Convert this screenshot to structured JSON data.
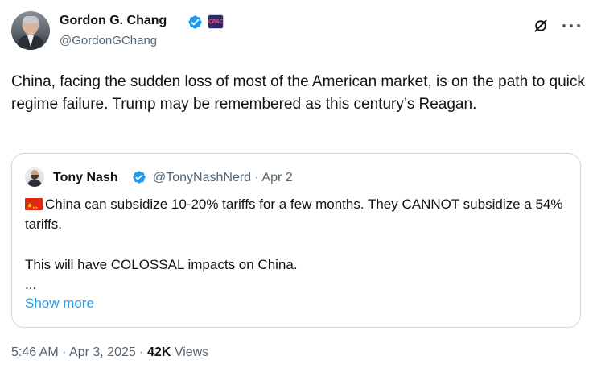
{
  "author": {
    "name": "Gordon G. Chang",
    "handle": "@GordonGChang",
    "verified": true,
    "affiliate_badge": "CPAC"
  },
  "tweet": {
    "text": "China, facing the sudden loss of most of the American market, is on the path to quick regime failure. Trump may be remembered as this century’s Reagan."
  },
  "quoted_tweet": {
    "name": "Tony Nash",
    "handle": "@TonyNashNerd",
    "separator": "·",
    "date": "Apr 2",
    "verified": true,
    "lines": [
      "China can subsidize 10-20% tariffs for a few months. They CANNOT subsidize a 54% tariffs.",
      "",
      "This will have COLOSSAL impacts on China.",
      "..."
    ],
    "flag_icon": "china-flag-icon",
    "show_more_label": "Show more"
  },
  "footer": {
    "time": "5:46 AM",
    "sep1": "·",
    "date": "Apr 3, 2025",
    "sep2": "·",
    "views_count": "42K",
    "views_label": "Views"
  },
  "colors": {
    "text": "#0f1419",
    "secondary": "#536471",
    "link": "#1d9bf0",
    "verified": "#1d9bf0",
    "border": "#cfd9de"
  },
  "icons": {
    "verified": "verified-badge-icon",
    "grok": "grok-icon",
    "more": "more-icon"
  }
}
